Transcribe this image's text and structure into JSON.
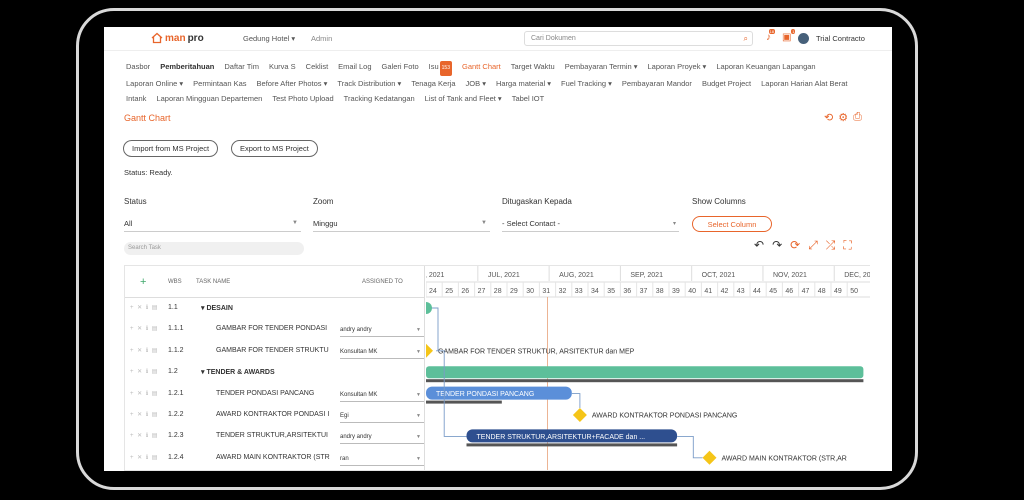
{
  "app": {
    "logo_a": "man",
    "logo_b": "pro",
    "project": "Gedung Hotel ▾",
    "role": "Admin",
    "search_placeholder": "Cari Dokumen",
    "user": "Trial Contracto",
    "notif_badges": [
      "18",
      "1"
    ]
  },
  "menu": [
    {
      "label": "Dasbor"
    },
    {
      "label": "Pemberitahuan",
      "style": "bold"
    },
    {
      "label": "Daftar Tim"
    },
    {
      "label": "Kurva S"
    },
    {
      "label": "Ceklist"
    },
    {
      "label": "Email Log"
    },
    {
      "label": "Galeri Foto"
    },
    {
      "label": "Isu",
      "badge": "153"
    },
    {
      "label": "Gantt Chart",
      "style": "active"
    },
    {
      "label": "Target Waktu"
    },
    {
      "label": "Pembayaran Termin ▾"
    },
    {
      "label": "Laporan Proyek ▾"
    },
    {
      "label": "Laporan Keuangan Lapangan"
    },
    {
      "label": "Laporan Online ▾"
    },
    {
      "label": "Permintaan Kas"
    },
    {
      "label": "Before After Photos ▾"
    },
    {
      "label": "Track Distribution ▾"
    },
    {
      "label": "Tenaga Kerja"
    },
    {
      "label": "JOB ▾"
    },
    {
      "label": "Harga material ▾"
    },
    {
      "label": "Fuel Tracking ▾"
    },
    {
      "label": "Pembayaran Mandor"
    },
    {
      "label": "Budget Project"
    },
    {
      "label": "Laporan Harian Alat Berat"
    },
    {
      "label": "Intank"
    },
    {
      "label": "Laporan Mingguan Departemen"
    },
    {
      "label": "Test Photo Upload"
    },
    {
      "label": "Tracking Kedatangan"
    },
    {
      "label": "List of Tank and Fleet ▾"
    },
    {
      "label": "Tabel IOT"
    }
  ],
  "page": {
    "title": "Gantt Chart",
    "import_btn": "Import from MS Project",
    "export_btn": "Export to MS Project",
    "status": "Status: Ready."
  },
  "filters": {
    "status_label": "Status",
    "status_value": "All",
    "zoom_label": "Zoom",
    "zoom_value": "Minggu",
    "assign_label": "Ditugaskan Kepada",
    "assign_value": "- Select Contact -",
    "columns_label": "Show Columns",
    "columns_btn": "Select Column",
    "task_search": "Search Task"
  },
  "grid_head": {
    "wbs": "WBS",
    "task": "TASK NAME",
    "assigned": "ASSIGNED TO"
  },
  "tasks": [
    {
      "wbs": "1.1",
      "name": "▾ DESAIN",
      "group": true,
      "assigned": ""
    },
    {
      "wbs": "1.1.1",
      "name": "GAMBAR FOR TENDER PONDASI",
      "group": false,
      "assigned": "andry andry"
    },
    {
      "wbs": "1.1.2",
      "name": "GAMBAR FOR TENDER STRUKTU",
      "group": false,
      "assigned": "Konsultan MK"
    },
    {
      "wbs": "1.2",
      "name": "▾ TENDER & AWARDS",
      "group": true,
      "assigned": ""
    },
    {
      "wbs": "1.2.1",
      "name": "TENDER PONDASI PANCANG",
      "group": false,
      "assigned": "Konsultan MK"
    },
    {
      "wbs": "1.2.2",
      "name": "AWARD KONTRAKTOR PONDASI I",
      "group": false,
      "assigned": "Egi"
    },
    {
      "wbs": "1.2.3",
      "name": "TENDER STRUKTUR,ARSITEKTUI",
      "group": false,
      "assigned": "andry andry"
    },
    {
      "wbs": "1.2.4",
      "name": "AWARD MAIN KONTRAKTOR (STR",
      "group": false,
      "assigned": "ran"
    }
  ],
  "timeline": {
    "months": [
      "I, 2021",
      "JUL, 2021",
      "AUG, 2021",
      "SEP, 2021",
      "OCT, 2021",
      "NOV, 2021",
      "DEC, 20"
    ],
    "weeks": [
      "24",
      "25",
      "26",
      "27",
      "28",
      "29",
      "30",
      "31",
      "32",
      "33",
      "34",
      "35",
      "36",
      "37",
      "38",
      "39",
      "40",
      "41",
      "42",
      "43",
      "44",
      "45",
      "46",
      "47",
      "48",
      "49",
      "50"
    ],
    "today_week": 31
  },
  "gantt": [
    {
      "row": 0,
      "kind": "group",
      "start": 23.5,
      "end": 24,
      "label": ""
    },
    {
      "row": 2,
      "kind": "milestone",
      "start": 24,
      "label": "GAMBAR FOR TENDER STRUKTUR, ARSITEKTUR dan MEP"
    },
    {
      "row": 3,
      "kind": "group",
      "start": 24,
      "end": 51,
      "label": ""
    },
    {
      "row": 4,
      "kind": "bar",
      "start": 24,
      "end": 33,
      "progress": 0.52,
      "label": "TENDER PONDASI PANCANG"
    },
    {
      "row": 5,
      "kind": "milestone",
      "start": 33.5,
      "label": "AWARD KONTRAKTOR PONDASI PANCANG"
    },
    {
      "row": 6,
      "kind": "bar-dark",
      "start": 26.5,
      "end": 39.5,
      "progress": 1,
      "label": "TENDER STRUKTUR,ARSITEKTUR+FACADE dan ..."
    },
    {
      "row": 7,
      "kind": "milestone",
      "start": 41.5,
      "label": "AWARD MAIN KONTRAKTOR (STR,AR"
    }
  ],
  "colors": {
    "accent": "#e8652b",
    "bar": "#5b8fd9",
    "bar_dark": "#2e4f8f",
    "group": "#5dbf9a",
    "milestone": "#f5c518",
    "today": "#e8a27a"
  }
}
